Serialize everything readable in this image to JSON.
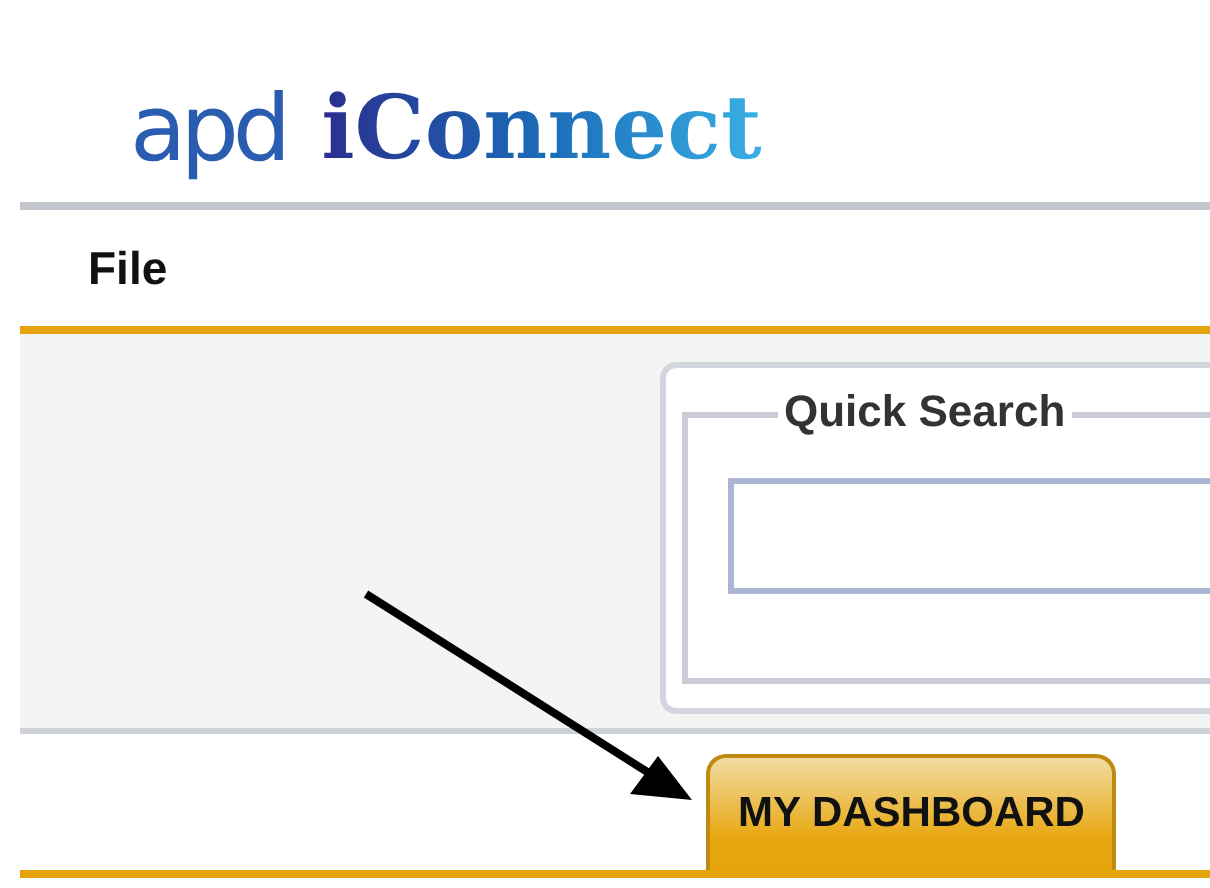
{
  "logo": {
    "mark": "apd",
    "name": "iConnect"
  },
  "menu": [
    {
      "label": "File"
    }
  ],
  "quick_search": {
    "legend": "Quick Search"
  },
  "tabs": [
    {
      "label": "MY DASHBOARD",
      "selected": true
    }
  ],
  "annotation": {
    "kind": "arrow"
  }
}
